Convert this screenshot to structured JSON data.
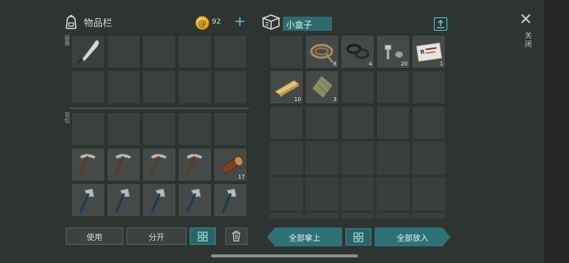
{
  "inventory": {
    "title": "物品栏",
    "coins": "92",
    "label_equip": "装备",
    "label_backpack": "背包"
  },
  "container": {
    "name": "小盒子",
    "items": [
      {
        "name": "rope",
        "count": "8"
      },
      {
        "name": "rubber-rings",
        "count": "4"
      },
      {
        "name": "bolts",
        "count": "20"
      },
      {
        "name": "id-card",
        "count": "1"
      },
      {
        "name": "wooden-plank",
        "count": "10"
      },
      {
        "name": "cloth-bundle",
        "count": "3"
      }
    ]
  },
  "backpack": {
    "log_count": "17"
  },
  "close_label": "关闭",
  "buttons": {
    "use": "使用",
    "split": "分开",
    "take_all": "全部拿上",
    "put_all": "全部放入"
  }
}
